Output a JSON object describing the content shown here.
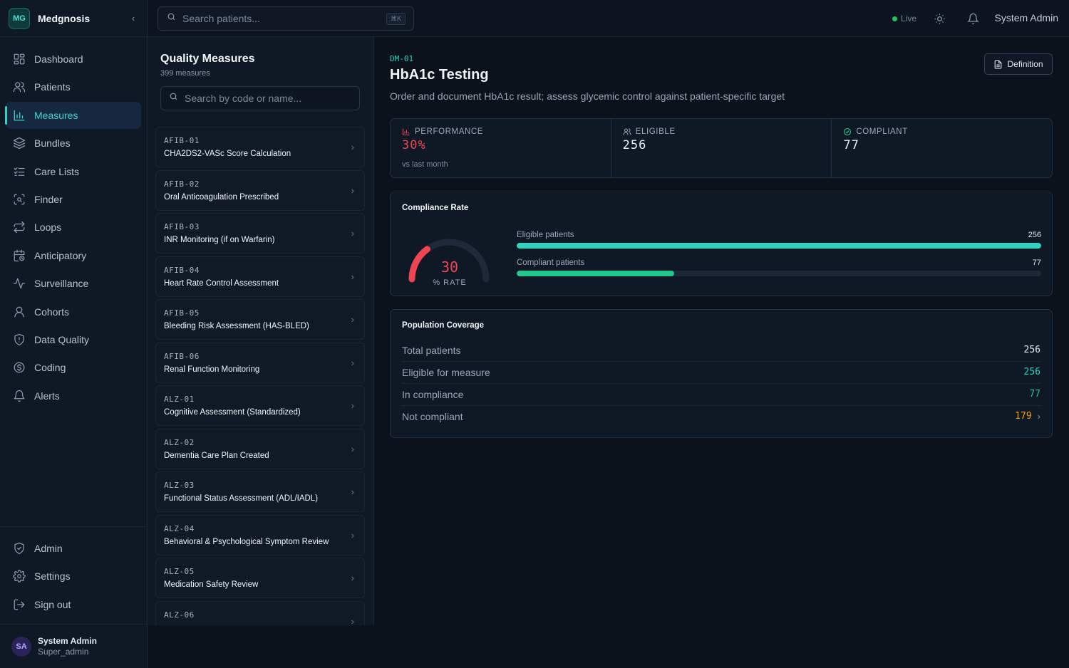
{
  "brand": {
    "initials": "MG",
    "name": "Medgnosis",
    "collapse_icon": "chevron-left-icon"
  },
  "nav": [
    {
      "label": "Dashboard",
      "icon": "dashboard-icon"
    },
    {
      "label": "Patients",
      "icon": "users-icon"
    },
    {
      "label": "Measures",
      "icon": "bar-chart-icon",
      "active": true
    },
    {
      "label": "Bundles",
      "icon": "layers-icon"
    },
    {
      "label": "Care Lists",
      "icon": "checklist-icon"
    },
    {
      "label": "Finder",
      "icon": "scan-search-icon"
    },
    {
      "label": "Loops",
      "icon": "repeat-icon"
    },
    {
      "label": "Anticipatory",
      "icon": "calendar-clock-icon"
    },
    {
      "label": "Surveillance",
      "icon": "activity-icon"
    },
    {
      "label": "Cohorts",
      "icon": "user-group-icon"
    },
    {
      "label": "Data Quality",
      "icon": "shield-alert-icon"
    },
    {
      "label": "Coding",
      "icon": "dollar-circle-icon"
    },
    {
      "label": "Alerts",
      "icon": "bell-icon"
    }
  ],
  "nav_bottom": [
    {
      "label": "Admin",
      "icon": "shield-check-icon"
    },
    {
      "label": "Settings",
      "icon": "gear-icon"
    },
    {
      "label": "Sign out",
      "icon": "logout-icon"
    }
  ],
  "user": {
    "initials": "SA",
    "name": "System Admin",
    "role": "Super_admin"
  },
  "topbar": {
    "search_placeholder": "Search patients...",
    "shortcut": "⌘K",
    "live_label": "Live",
    "user_name": "System Admin"
  },
  "measures_panel": {
    "title": "Quality Measures",
    "count": "399 measures",
    "search_placeholder": "Search by code or name...",
    "items": [
      {
        "code": "AFIB-01",
        "name": "CHA2DS2-VASc Score Calculation"
      },
      {
        "code": "AFIB-02",
        "name": "Oral Anticoagulation Prescribed"
      },
      {
        "code": "AFIB-03",
        "name": "INR Monitoring (if on Warfarin)"
      },
      {
        "code": "AFIB-04",
        "name": "Heart Rate Control Assessment"
      },
      {
        "code": "AFIB-05",
        "name": "Bleeding Risk Assessment (HAS-BLED)"
      },
      {
        "code": "AFIB-06",
        "name": "Renal Function Monitoring"
      },
      {
        "code": "ALZ-01",
        "name": "Cognitive Assessment (Standardized)"
      },
      {
        "code": "ALZ-02",
        "name": "Dementia Care Plan Created"
      },
      {
        "code": "ALZ-03",
        "name": "Functional Status Assessment (ADL/IADL)"
      },
      {
        "code": "ALZ-04",
        "name": "Behavioral & Psychological Symptom Review"
      },
      {
        "code": "ALZ-05",
        "name": "Medication Safety Review"
      },
      {
        "code": "ALZ-06",
        "name": ""
      }
    ]
  },
  "detail": {
    "code": "DM-01",
    "title": "HbA1c Testing",
    "description": "Order and document HbA1c result; assess glycemic control against patient-specific target",
    "definition_label": "Definition",
    "stats": {
      "performance": {
        "label": "PERFORMANCE",
        "value": "30%",
        "sub": "vs last month",
        "color": "#ef4452"
      },
      "eligible": {
        "label": "ELIGIBLE",
        "value": "256"
      },
      "compliant": {
        "label": "COMPLIANT",
        "value": "77"
      }
    },
    "compliance": {
      "title": "Compliance Rate",
      "rate": 30,
      "rate_value": "30",
      "rate_label": "% RATE",
      "bars": [
        {
          "label": "Eligible patients",
          "value": "256",
          "fraction": 1.0,
          "color": "#2dd4bf"
        },
        {
          "label": "Compliant patients",
          "value": "77",
          "fraction": 0.3,
          "color": "#22c58b"
        }
      ]
    },
    "population": {
      "title": "Population Coverage",
      "rows": [
        {
          "label": "Total patients",
          "value": "256",
          "color": "#e6ebf2"
        },
        {
          "label": "Eligible for measure",
          "value": "256",
          "color": "#2dd4bf"
        },
        {
          "label": "In compliance",
          "value": "77",
          "color": "#22c58b"
        },
        {
          "label": "Not compliant",
          "value": "179",
          "color": "#f59e0b",
          "chevron": true
        }
      ]
    }
  }
}
